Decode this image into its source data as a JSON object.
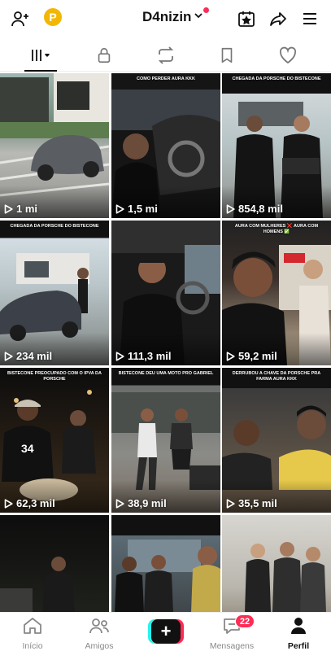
{
  "header": {
    "username": "D4nizin",
    "coin_letter": "P",
    "icons": [
      "add-friend-icon",
      "coin-icon",
      "chevron-down-icon",
      "calendar-star-icon",
      "share-icon",
      "menu-icon"
    ],
    "notification_dot_color": "#fe2c55"
  },
  "tabs": [
    {
      "name": "videos-grid",
      "icon": "grid-icon",
      "active": true
    },
    {
      "name": "private",
      "icon": "lock-icon",
      "active": false
    },
    {
      "name": "reposts",
      "icon": "repost-icon",
      "active": false
    },
    {
      "name": "favorites",
      "icon": "bookmark-icon",
      "active": false
    },
    {
      "name": "liked",
      "icon": "heart-icon",
      "active": false
    }
  ],
  "videos": [
    {
      "caption": "",
      "views": "1 mi"
    },
    {
      "caption": "COMO PERDER AURA KKK",
      "views": "1,5 mi"
    },
    {
      "caption": "CHEGADA DA PORSCHE DO BISTECONE",
      "views": "854,8 mil"
    },
    {
      "caption": "CHEGADA DA PORSCHE DO BISTECONE",
      "views": "234 mil"
    },
    {
      "caption": "",
      "views": "111,3 mil"
    },
    {
      "caption": "AURA COM MULHERES ❌ AURA COM HOMENS ✅",
      "views": "59,2 mil"
    },
    {
      "caption": "BISTECONE PREOCUPADO COM O IPVA DA PORSCHE",
      "views": "62,3 mil"
    },
    {
      "caption": "BISTECONE DEU UMA MOTO PRO GABRIEL",
      "views": "38,9 mil"
    },
    {
      "caption": "DERRUBOU A CHAVE DA PORSCHE PRA FARMA AURA KKK",
      "views": "35,5 mil"
    },
    {
      "caption": "",
      "views": ""
    },
    {
      "caption": "",
      "views": ""
    },
    {
      "caption": "",
      "views": ""
    }
  ],
  "bottom_nav": {
    "home": "Início",
    "friends": "Amigos",
    "create_icon": "plus-icon",
    "inbox": "Mensagens",
    "inbox_badge": "22",
    "profile": "Perfil"
  },
  "colors": {
    "accent_red": "#fe2c55",
    "accent_cyan": "#25f4ee",
    "coin": "#f2b705"
  }
}
